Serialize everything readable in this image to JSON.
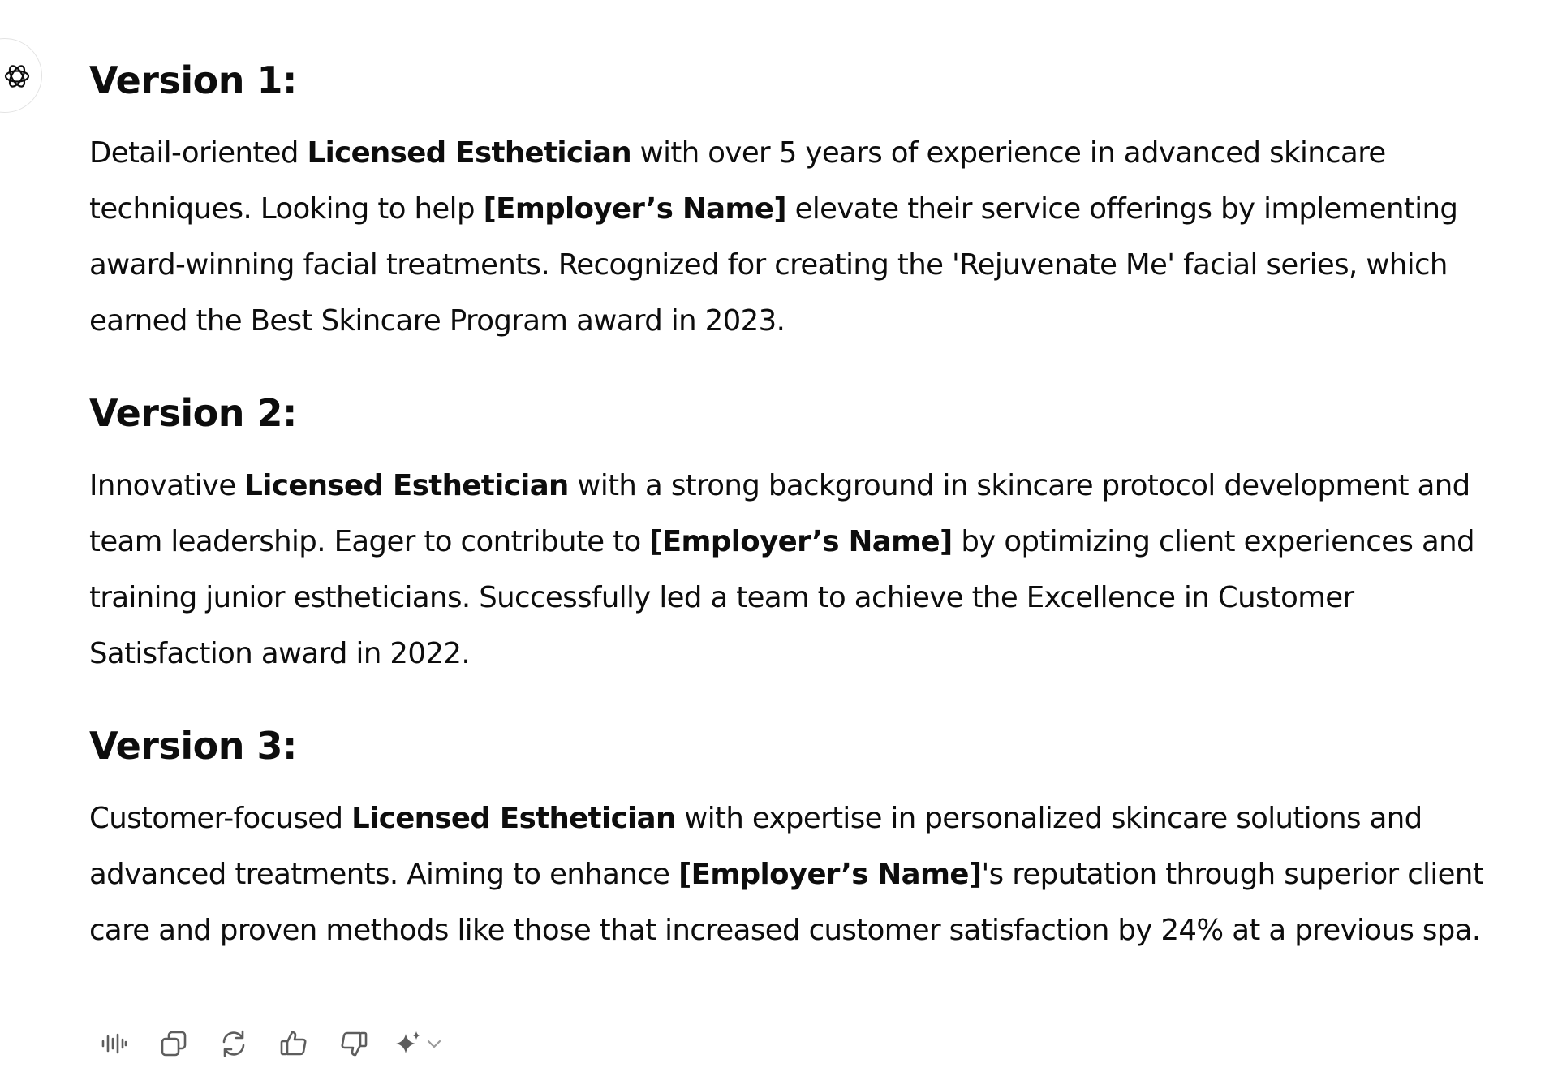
{
  "assistant": {
    "avatar_icon": "openai-logo-icon"
  },
  "versions": [
    {
      "heading": "Version 1:",
      "segments": [
        {
          "text": "Detail-oriented "
        },
        {
          "text": "Licensed Esthetician",
          "bold": true
        },
        {
          "text": " with over 5 years of experience in advanced skincare"
        },
        {
          "br": true
        },
        {
          "text": "techniques. Looking to help "
        },
        {
          "text": "[Employer’s Name]",
          "bold": true
        },
        {
          "text": " elevate their service offerings by implementing"
        },
        {
          "br": true
        },
        {
          "text": "award-winning facial treatments. Recognized for creating the 'Rejuvenate Me' facial series, which"
        },
        {
          "br": true
        },
        {
          "text": "earned the Best Skincare Program award in 2023."
        }
      ]
    },
    {
      "heading": "Version 2:",
      "segments": [
        {
          "text": "Innovative "
        },
        {
          "text": "Licensed Esthetician",
          "bold": true
        },
        {
          "text": " with a strong background in skincare protocol development and"
        },
        {
          "br": true
        },
        {
          "text": "team leadership. Eager to contribute to "
        },
        {
          "text": "[Employer’s Name]",
          "bold": true
        },
        {
          "text": " by optimizing client experiences and"
        },
        {
          "br": true
        },
        {
          "text": "training junior estheticians. Successfully led a team to achieve the Excellence in Customer"
        },
        {
          "br": true
        },
        {
          "text": "Satisfaction award in 2022."
        }
      ]
    },
    {
      "heading": "Version 3:",
      "segments": [
        {
          "text": "Customer-focused "
        },
        {
          "text": "Licensed Esthetician",
          "bold": true
        },
        {
          "text": " with expertise in personalized skincare solutions and"
        },
        {
          "br": true
        },
        {
          "text": "advanced treatments. Aiming to enhance "
        },
        {
          "text": "[Employer’s Name]",
          "bold": true
        },
        {
          "text": "'s reputation through superior client"
        },
        {
          "br": true
        },
        {
          "text": "care and proven methods like those that increased customer satisfaction by 24% at a previous spa."
        }
      ]
    }
  ],
  "toolbar": {
    "buttons": [
      {
        "name": "read-aloud-button",
        "icon": "speaker-waveform-icon"
      },
      {
        "name": "copy-button",
        "icon": "copy-icon"
      },
      {
        "name": "regenerate-button",
        "icon": "refresh-icon"
      },
      {
        "name": "good-response-button",
        "icon": "thumbs-up-icon"
      },
      {
        "name": "bad-response-button",
        "icon": "thumbs-down-icon"
      }
    ],
    "model_switcher": {
      "icon": "sparkle-icon",
      "chevron": "chevron-down-icon"
    }
  },
  "colors": {
    "text": "#0d0d0d",
    "icon": "#5d5d5d",
    "avatar_border": "#e3e3e3"
  }
}
